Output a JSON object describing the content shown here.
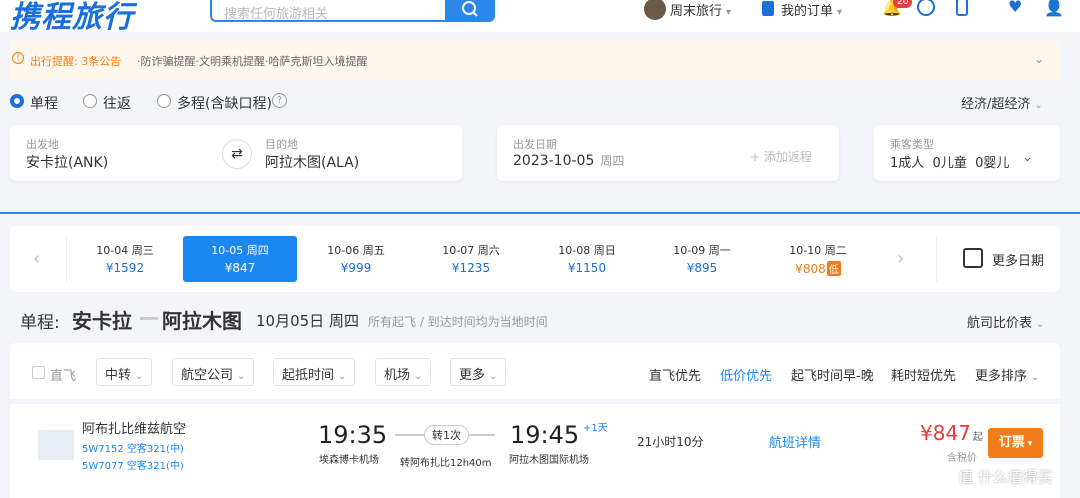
{
  "header": {
    "logo": "携程旅行",
    "search_placeholder": "搜索任何旅游相关",
    "user_name": "周末旅行",
    "orders": "我的订单",
    "notif_count": "20"
  },
  "notice": {
    "title": "出行提醒: 3条公告",
    "body": "·防诈骗提醒·文明乘机提醒·哈萨克斯坦入境提醒"
  },
  "trip_type": {
    "options": [
      "单程",
      "往返",
      "多程(含缺口程)"
    ],
    "selected": 0,
    "cabin": "经济/超经济"
  },
  "search": {
    "from_label": "出发地",
    "from_value": "安卡拉(ANK)",
    "to_label": "目的地",
    "to_value": "阿拉木图(ALA)",
    "date_label": "出发日期",
    "date_value": "2023-10-05",
    "date_weekday": "周四",
    "add_return": "+ 添加返程",
    "pax_label": "乘客类型",
    "pax_adult": "1成人",
    "pax_child": "0儿童",
    "pax_infant": "0婴儿"
  },
  "dates": [
    {
      "date": "10-04",
      "weekday": "周三",
      "price": "¥1592"
    },
    {
      "date": "10-05",
      "weekday": "周四",
      "price": "¥847",
      "selected": true
    },
    {
      "date": "10-06",
      "weekday": "周五",
      "price": "¥999"
    },
    {
      "date": "10-07",
      "weekday": "周六",
      "price": "¥1235"
    },
    {
      "date": "10-08",
      "weekday": "周日",
      "price": "¥1150"
    },
    {
      "date": "10-09",
      "weekday": "周一",
      "price": "¥895"
    },
    {
      "date": "10-10",
      "weekday": "周二",
      "price": "¥808",
      "tag": "低"
    }
  ],
  "more_dates": "更多日期",
  "route": {
    "prefix": "单程:",
    "from_city": "安卡拉",
    "to_city": "阿拉木图",
    "date": "10月05日 周四",
    "note": "所有起飞 / 到达时间均为当地时间",
    "compare": "航司比价表"
  },
  "filters": {
    "direct": "直飞",
    "buttons": [
      "中转",
      "航空公司",
      "起抵时间",
      "机场",
      "更多"
    ],
    "sorts": [
      "直飞优先",
      "低价优先",
      "起飞时间早-晚",
      "耗时短优先",
      "更多排序"
    ],
    "active_sort": 1
  },
  "flight": {
    "airline": "阿布扎比维兹航空",
    "flight1": "5W7152 空客321(中)",
    "flight2": "5W7077 空客321(中)",
    "dep_time": "19:35",
    "dep_airport": "埃森博卡机场",
    "stops": "转1次",
    "transfer": "转阿布扎比12h40m",
    "arr_time": "19:45",
    "arr_day": "+1天",
    "arr_airport": "阿拉木图国际机场",
    "duration": "21小时10分",
    "details": "航班详情",
    "price": "¥847",
    "price_suffix": "起",
    "tax_note": "含税价",
    "book": "订票"
  },
  "watermark": "值 什么值得买",
  "colors": {
    "primary": "#1a88f0",
    "accent": "#f07d1a",
    "price": "#e83c3c"
  }
}
